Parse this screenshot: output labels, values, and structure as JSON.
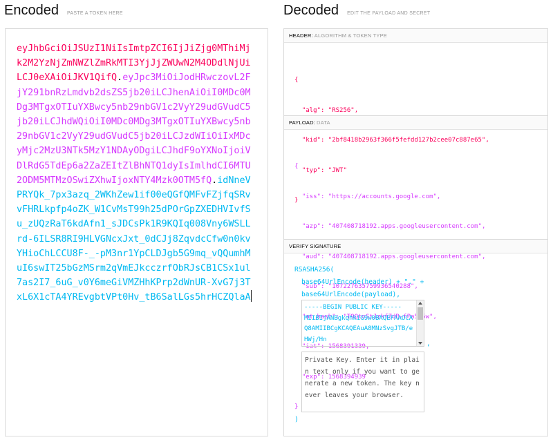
{
  "encoded": {
    "title": "Encoded",
    "subtitle": "PASTE A TOKEN HERE",
    "token_header": "eyJhbGciOiJSUzI1NiIsImtpZCI6IjJiZjg0MThiMjk2M2YzNjZmNWZlZmRkMTI3YjJjZWUwN2M4ODdlNjUiLCJ0eXAiOiJKV1QifQ",
    "dot1": ".",
    "token_payload": "eyJpc3MiOiJodHRwczovL2FjY291bnRzLmdvb2dsZS5jb20iLCJhenAiOiI0MDc0MDg3MTgxOTIuYXBwcy5nb29nbGV1c2VyY29udGVudC5jb20iLCJhdWQiOiI0MDc0MDg3MTgxOTIuYXBwcy5nb29nbGV1c2VyY29udGVudC5jb20iLCJzdWIiOiIxMDcyMjc2MzU3NTk5MzY1NDAyODgiLCJhdF9oYXNoIjoiVDlRdG5TdEp6a2ZaZEItZlBhNTQ1dyIsImlhdCI6MTU2ODM5MTMzOSwiZXhwIjoxNTY4Mzk0OTM5fQ",
    "dot2": ".",
    "token_signature": "idNneVPRYQk_7px3azq_2WKhZew1if00eQGfQMFvFZjfqSRvvFHRLkpfp4oZK_W1CvMsT99h25dPOrGpZXEDHVIvfSu_zUQzRaT6kdAfn1_sJDCsPk1R9KQIq008Vny6WSLLrd-6ILSR8RI9HLVGNcxJxt_0dCJj8ZqvdcCfw0n0kvYHioChLCCU8F-_-pM3nr1YpCLDJgb5G9mq_vQQumhMuI6swIT25bGzMSrm2qVmEJkcczrfObRJsCB1CSx1ul7as2I7_6uG_v0Y6meGiVMZHhKPrp2dWnUR-XvG7j3TxL6X1cTA4YREvgbtVPt0Hv_tB6SalLGs5hrHCZQlaA"
  },
  "decoded": {
    "title": "Decoded",
    "subtitle": "EDIT THE PAYLOAD AND SECRET",
    "header_label": "HEADER:",
    "header_sublabel": "ALGORITHM & TOKEN TYPE",
    "header_json": [
      {
        "key": "\"alg\"",
        "value": "\"RS256\","
      },
      {
        "key": "\"kid\"",
        "value": "\"2bf8418b2963f366f5fefdd127b2cee07c887e65\","
      },
      {
        "key": "\"typ\"",
        "value": "\"JWT\""
      }
    ],
    "payload_label": "PAYLOAD:",
    "payload_sublabel": "DATA",
    "payload_json": [
      {
        "key": "\"iss\"",
        "value": "\"https://accounts.google.com\","
      },
      {
        "key": "\"azp\"",
        "value": "\"407408718192.apps.googleusercontent.com\","
      },
      {
        "key": "\"aud\"",
        "value": "\"407408718192.apps.googleusercontent.com\","
      },
      {
        "key": "\"sub\"",
        "value": "\"107227635759936540288\","
      },
      {
        "key": "\"at_hash\"",
        "value": "\"T9QtnStJzkfZdB-fPa545w\","
      },
      {
        "key": "\"iat\"",
        "value": "1568391339,"
      },
      {
        "key": "\"exp\"",
        "value": "1568394939"
      }
    ],
    "signature_label": "VERIFY SIGNATURE",
    "sig_fn": "RSASHA256(",
    "sig_line1": "base64UrlEncode(header) + \".\" +",
    "sig_line2": "base64UrlEncode(payload),",
    "public_key": "-----BEGIN PUBLIC KEY-----\nMIIBIjANBgkqhkiG9w0BAQEFAAOCAQ8AMIIBCgKCAQEAuA8MNzSvgJTB/eHWj/Hn",
    "comma": ",",
    "private_key_placeholder": "Private Key. Enter it in plain text only if you want to generate a new token. The key never leaves your browser.",
    "close_paren": ")"
  }
}
